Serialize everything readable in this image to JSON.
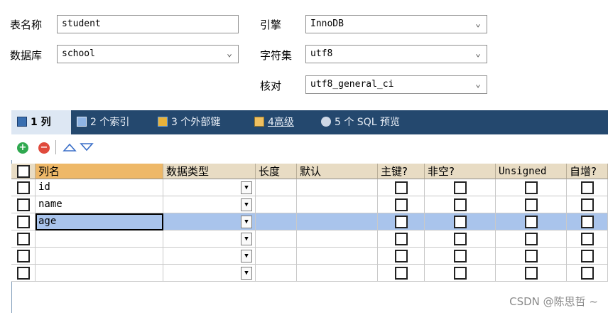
{
  "form": {
    "table_name_label": "表名称",
    "table_name_value": "student",
    "database_label": "数据库",
    "database_value": "school",
    "engine_label": "引擎",
    "engine_value": "InnoDB",
    "charset_label": "字符集",
    "charset_value": "utf8",
    "collation_label": "核对",
    "collation_value": "utf8_general_ci"
  },
  "tabs": [
    {
      "label": "1 列",
      "active": true,
      "icon": "columns-icon"
    },
    {
      "label": "2 个索引",
      "active": false,
      "icon": "index-icon"
    },
    {
      "label": "3 个外部键",
      "active": false,
      "icon": "foreign-key-icon"
    },
    {
      "label": "4高级",
      "active": false,
      "icon": "advanced-icon"
    },
    {
      "label": "5 个 SQL 预览",
      "active": false,
      "icon": "sql-preview-icon"
    }
  ],
  "toolbar": {
    "add_icon": "add-icon",
    "remove_icon": "remove-icon",
    "up_icon": "move-up-icon",
    "down_icon": "move-down-icon"
  },
  "grid": {
    "headers": [
      "列名",
      "数据类型",
      "长度",
      "默认",
      "主键?",
      "非空?",
      "Unsigned",
      "自增?"
    ],
    "rows": [
      {
        "name": "id",
        "selected": false
      },
      {
        "name": "name",
        "selected": false
      },
      {
        "name": "age",
        "selected": true
      },
      {
        "name": "",
        "selected": false
      },
      {
        "name": "",
        "selected": false
      },
      {
        "name": "",
        "selected": false
      }
    ]
  },
  "watermark": "CSDN @陈思哲 ~",
  "colors": {
    "tabbar": "#24486e",
    "selected_row": "#a9c4ec",
    "header_first": "#eeb868",
    "header": "#e8dcc4"
  }
}
